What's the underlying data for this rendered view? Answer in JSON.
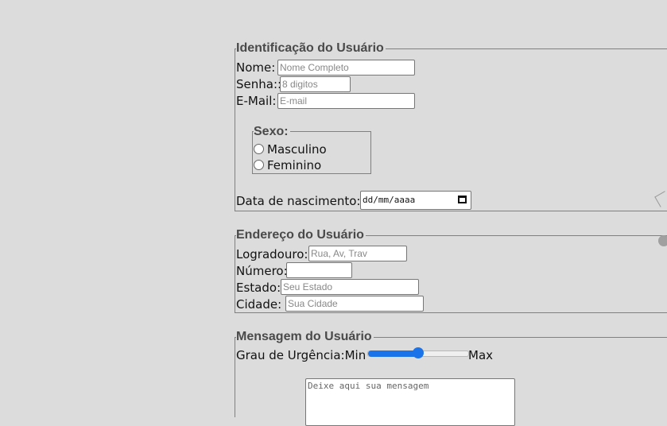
{
  "identificacao": {
    "legend": "Identificação do Usuário",
    "nome_label": "Nome:",
    "nome_placeholder": "Nome Completo",
    "senha_label": "Senha::",
    "senha_placeholder": "8 digitos",
    "email_label": "E-Mail:",
    "email_placeholder": "E-mail",
    "sexo": {
      "legend": "Sexo:",
      "options": [
        "Masculino",
        "Feminino"
      ]
    },
    "nascimento_label": "Data de nascimento:",
    "nascimento_placeholder": "dd/mm/aaaa"
  },
  "endereco": {
    "legend": "Endereço do Usuário",
    "logradouro_label": "Logradouro:",
    "logradouro_placeholder": "Rua, Av, Trav",
    "numero_label": "Número:",
    "numero_placeholder": "",
    "estado_label": "Estado:",
    "estado_placeholder": "Seu Estado",
    "cidade_label": "Cidade:",
    "cidade_placeholder": "Sua Cidade"
  },
  "mensagem": {
    "legend": "Mensagem do Usuário",
    "urgencia_label": "Grau de Urgência:",
    "min_label": "Min",
    "max_label": "Max",
    "urgencia_level": 0.5,
    "mensagem_placeholder": "Deixe aqui sua mensagem"
  },
  "colors": {
    "background": "#dcdcdc",
    "accent": "#1a73e8",
    "legend_text": "#4a4a4a"
  }
}
